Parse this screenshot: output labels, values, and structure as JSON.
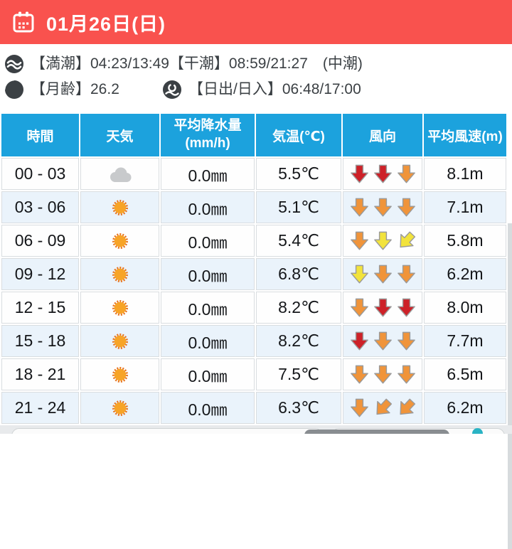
{
  "header": {
    "date_label": "01月26日(日)"
  },
  "almanac": {
    "tide": "【満潮】04:23/13:49【干潮】08:59/21:27　(中潮)",
    "moon": "【月齢】26.2",
    "sunrise": "【日出/日入】06:48/17:00"
  },
  "table": {
    "headers": {
      "time": "時間",
      "weather": "天気",
      "precip_line1": "平均降水量",
      "precip_line2": "(mm/h)",
      "temp": "気温(℃)",
      "wind": "風向",
      "speed": "平均風速(m)"
    },
    "wind_colors": {
      "red": "#cd2128",
      "orange": "#f0943a",
      "yellow": "#f2e33c"
    },
    "rows": [
      {
        "time": "00 - 03",
        "weather": "cloud",
        "precip": "0.0㎜",
        "temp": "5.5℃",
        "wind": [
          {
            "color": "red",
            "dir": "s"
          },
          {
            "color": "red",
            "dir": "s"
          },
          {
            "color": "orange",
            "dir": "s"
          }
        ],
        "speed": "8.1m"
      },
      {
        "time": "03 - 06",
        "weather": "sun",
        "precip": "0.0㎜",
        "temp": "5.1℃",
        "wind": [
          {
            "color": "orange",
            "dir": "s"
          },
          {
            "color": "orange",
            "dir": "s"
          },
          {
            "color": "orange",
            "dir": "s"
          }
        ],
        "speed": "7.1m"
      },
      {
        "time": "06 - 09",
        "weather": "sun",
        "precip": "0.0㎜",
        "temp": "5.4℃",
        "wind": [
          {
            "color": "orange",
            "dir": "s"
          },
          {
            "color": "yellow",
            "dir": "s"
          },
          {
            "color": "yellow",
            "dir": "sw"
          }
        ],
        "speed": "5.8m"
      },
      {
        "time": "09 - 12",
        "weather": "sun",
        "precip": "0.0㎜",
        "temp": "6.8℃",
        "wind": [
          {
            "color": "yellow",
            "dir": "s"
          },
          {
            "color": "orange",
            "dir": "s"
          },
          {
            "color": "orange",
            "dir": "s"
          }
        ],
        "speed": "6.2m"
      },
      {
        "time": "12 - 15",
        "weather": "sun",
        "precip": "0.0㎜",
        "temp": "8.2℃",
        "wind": [
          {
            "color": "orange",
            "dir": "s"
          },
          {
            "color": "red",
            "dir": "s"
          },
          {
            "color": "red",
            "dir": "s"
          }
        ],
        "speed": "8.0m"
      },
      {
        "time": "15 - 18",
        "weather": "sun",
        "precip": "0.0㎜",
        "temp": "8.2℃",
        "wind": [
          {
            "color": "red",
            "dir": "s"
          },
          {
            "color": "orange",
            "dir": "s"
          },
          {
            "color": "orange",
            "dir": "s"
          }
        ],
        "speed": "7.7m"
      },
      {
        "time": "18 - 21",
        "weather": "sun",
        "precip": "0.0㎜",
        "temp": "7.5℃",
        "wind": [
          {
            "color": "orange",
            "dir": "s"
          },
          {
            "color": "orange",
            "dir": "s"
          },
          {
            "color": "orange",
            "dir": "s"
          }
        ],
        "speed": "6.5m"
      },
      {
        "time": "21 - 24",
        "weather": "sun",
        "precip": "0.0㎜",
        "temp": "6.3℃",
        "wind": [
          {
            "color": "orange",
            "dir": "s"
          },
          {
            "color": "orange",
            "dir": "sw"
          },
          {
            "color": "orange",
            "dir": "sw"
          }
        ],
        "speed": "6.2m"
      }
    ]
  },
  "colors": {
    "header_red": "#f9524e",
    "table_header_blue": "#1ca2dd",
    "row_alt_blue": "#eaf3fb",
    "sun_fill": "#f7a427",
    "sun_ring": "#e87723",
    "cloud_gray": "#c8cacc"
  }
}
